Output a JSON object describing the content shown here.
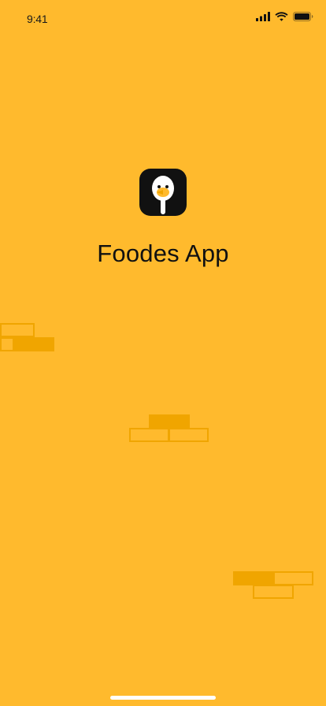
{
  "status_bar": {
    "time": "9:41",
    "icons": [
      "cellular-signal-icon",
      "wifi-icon",
      "battery-icon"
    ]
  },
  "app": {
    "logo_icon": "duck-spoon-logo-icon",
    "title": "Foodes App"
  },
  "colors": {
    "background": "#FFBA2D",
    "brick": "#F0A500",
    "logo_bg": "#111111",
    "text": "#111111"
  }
}
